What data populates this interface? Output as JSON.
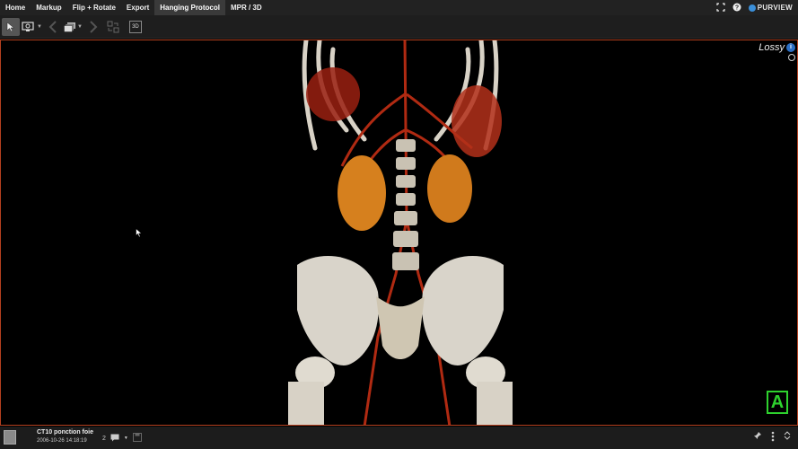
{
  "menu": {
    "items": [
      {
        "label": "Home"
      },
      {
        "label": "Markup"
      },
      {
        "label": "Flip + Rotate"
      },
      {
        "label": "Export"
      },
      {
        "label": "Hanging Protocol"
      },
      {
        "label": "MPR / 3D"
      }
    ],
    "active_index": 4,
    "brand": "PURVIEW"
  },
  "toolbar": {
    "icons": [
      "pointer-icon",
      "monitor-layout-icon",
      "back-arrow-icon",
      "stack-icon",
      "forward-arrow-icon",
      "tile-icon"
    ],
    "btn_3d": "3D"
  },
  "viewport": {
    "compression_label": "Lossy",
    "info_glyph": "i",
    "orientation_marker": "A",
    "border_color": "#b3401f",
    "marker_color": "#2ed12e"
  },
  "status": {
    "series_name": "CT10 ponction foie",
    "series_datetime": "2006-10-26 14:18:19",
    "badge": "2"
  }
}
